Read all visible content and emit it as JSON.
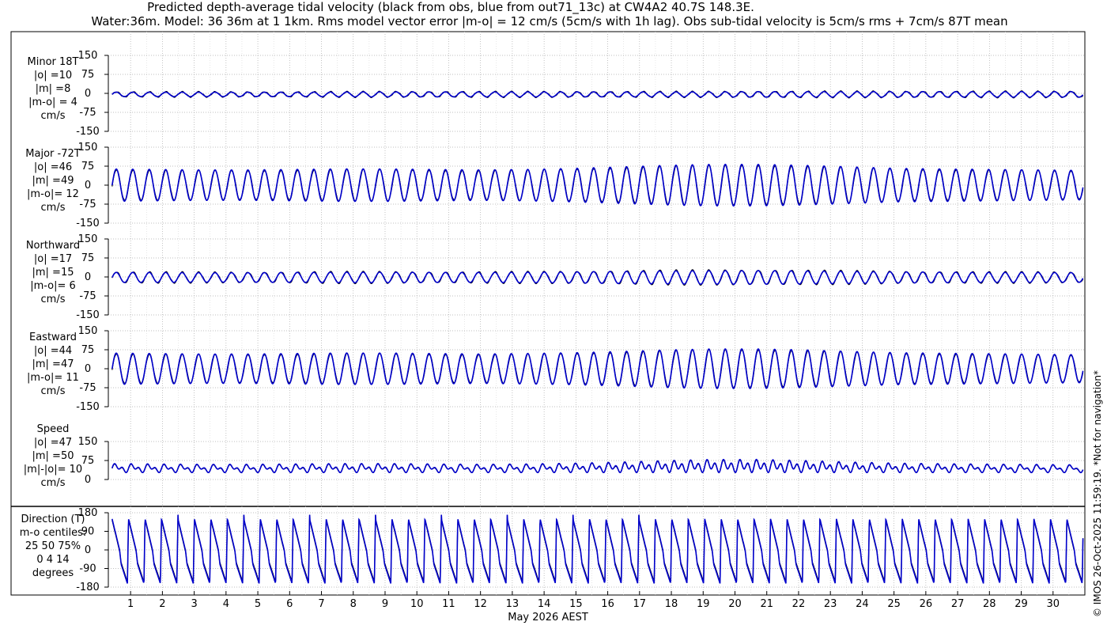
{
  "title": "Predicted depth-average tidal velocity (black from obs, blue from out71_13c) at CW4A2 40.7S 148.3E.",
  "subtitle": "Water:36m. Model: 36 36m at 1 1km. Rms model vector error |m-o| = 12 cm/s (5cm/s with 1h lag). Obs sub-tidal velocity is 5cm/s rms + 7cm/s 87T mean",
  "xlabel": "May 2026 AEST",
  "watermark": "© IMOS 26-Oct-2025 11:59:19. *Not for navigation*",
  "colors": {
    "obs": "#000000",
    "model": "#0000cc",
    "grid": "#aaaaaa"
  },
  "chart_data": [
    {
      "type": "line",
      "panel": "minor",
      "label_lines": [
        "Minor 18T",
        "|o| =10",
        "|m| =8",
        "|m-o| = 4",
        "cm/s"
      ],
      "ylim": [
        -150,
        150
      ],
      "yticks": [
        150,
        75,
        0,
        -75,
        -150
      ],
      "xlim": [
        0.3,
        31
      ],
      "x_ticks": [
        1,
        2,
        3,
        4,
        5,
        6,
        7,
        8,
        9,
        10,
        11,
        12,
        13,
        14,
        15,
        16,
        17,
        18,
        19,
        20,
        21,
        22,
        23,
        24,
        25,
        26,
        27,
        28,
        29,
        30
      ],
      "period_days": 0.5175,
      "amplitude_envelope": [
        9,
        9,
        9,
        9,
        10,
        10,
        10,
        10,
        10,
        10,
        11,
        11,
        11,
        11,
        11,
        11
      ],
      "offset": -4,
      "series": [
        {
          "name": "obs",
          "amp_scale": 1.1
        },
        {
          "name": "model",
          "amp_scale": 1.0
        }
      ]
    },
    {
      "type": "line",
      "panel": "major",
      "label_lines": [
        "Major -72T",
        "|o| =46",
        "|m| =49",
        "|m-o|= 12",
        "cm/s"
      ],
      "ylim": [
        -150,
        150
      ],
      "yticks": [
        150,
        75,
        0,
        -75,
        -150
      ],
      "xlim": [
        0.3,
        31
      ],
      "x_ticks": [
        1,
        2,
        3,
        4,
        5,
        6,
        7,
        8,
        9,
        10,
        11,
        12,
        13,
        14,
        15,
        16,
        17,
        18,
        19,
        20,
        21,
        22,
        23,
        24,
        25,
        26,
        27,
        28,
        29,
        30
      ],
      "period_days": 0.5175,
      "amplitude_envelope": [
        64,
        62,
        60,
        60,
        62,
        64,
        64,
        62,
        60,
        62,
        66,
        72,
        78,
        82,
        82,
        78,
        72,
        66,
        64,
        62,
        60,
        58
      ],
      "offset": 0,
      "series": [
        {
          "name": "obs",
          "amp_scale": 0.96
        },
        {
          "name": "model",
          "amp_scale": 1.0
        }
      ]
    },
    {
      "type": "line",
      "panel": "northward",
      "label_lines": [
        "Northward",
        "|o| =17",
        "|m| =15",
        "|m-o|= 6",
        "cm/s"
      ],
      "ylim": [
        -150,
        150
      ],
      "yticks": [
        150,
        75,
        0,
        -75,
        -150
      ],
      "xlim": [
        0.3,
        31
      ],
      "x_ticks": [
        1,
        2,
        3,
        4,
        5,
        6,
        7,
        8,
        9,
        10,
        11,
        12,
        13,
        14,
        15,
        16,
        17,
        18,
        19,
        20,
        21,
        22,
        23,
        24,
        25,
        26,
        27,
        28,
        29,
        30
      ],
      "period_days": 0.5175,
      "amplitude_envelope": [
        20,
        20,
        19,
        19,
        20,
        21,
        21,
        20,
        20,
        21,
        22,
        24,
        26,
        27,
        27,
        26,
        24,
        22,
        21,
        20,
        20,
        19
      ],
      "offset": -2,
      "series": [
        {
          "name": "obs",
          "amp_scale": 1.08
        },
        {
          "name": "model",
          "amp_scale": 1.0
        }
      ]
    },
    {
      "type": "line",
      "panel": "eastward",
      "label_lines": [
        "Eastward",
        "|o| =44",
        "|m| =47",
        "|m-o|= 11",
        "cm/s"
      ],
      "ylim": [
        -150,
        150
      ],
      "yticks": [
        150,
        75,
        0,
        -75,
        -150
      ],
      "xlim": [
        0.3,
        31
      ],
      "x_ticks": [
        1,
        2,
        3,
        4,
        5,
        6,
        7,
        8,
        9,
        10,
        11,
        12,
        13,
        14,
        15,
        16,
        17,
        18,
        19,
        20,
        21,
        22,
        23,
        24,
        25,
        26,
        27,
        28,
        29,
        30
      ],
      "period_days": 0.5175,
      "amplitude_envelope": [
        62,
        60,
        58,
        58,
        60,
        62,
        62,
        60,
        58,
        60,
        63,
        68,
        74,
        78,
        78,
        74,
        68,
        63,
        61,
        59,
        57,
        55
      ],
      "offset": 0,
      "series": [
        {
          "name": "obs",
          "amp_scale": 0.96
        },
        {
          "name": "model",
          "amp_scale": 1.0
        }
      ]
    },
    {
      "type": "line",
      "panel": "speed",
      "label_lines": [
        "Speed",
        "|o| =47",
        "|m| =50",
        "|m|-|o|= 10",
        "cm/s"
      ],
      "ylim": [
        0,
        150
      ],
      "yticks": [
        150,
        75,
        0
      ],
      "xlim": [
        0.3,
        31
      ],
      "x_ticks": [
        1,
        2,
        3,
        4,
        5,
        6,
        7,
        8,
        9,
        10,
        11,
        12,
        13,
        14,
        15,
        16,
        17,
        18,
        19,
        20,
        21,
        22,
        23,
        24,
        25,
        26,
        27,
        28,
        29,
        30
      ],
      "period_days": 0.5175,
      "amplitude_envelope": [
        62,
        60,
        58,
        58,
        60,
        62,
        62,
        60,
        58,
        60,
        64,
        70,
        78,
        84,
        84,
        78,
        70,
        64,
        61,
        59,
        57,
        55
      ],
      "offset": 0,
      "series": [
        {
          "name": "obs",
          "amp_scale": 0.96
        },
        {
          "name": "model",
          "amp_scale": 1.0
        }
      ]
    },
    {
      "type": "line",
      "panel": "direction",
      "label_lines": [
        "Direction (T)",
        "m-o centiles:",
        "25  50  75%",
        "0   4  14",
        "degrees"
      ],
      "ylim": [
        -180,
        180
      ],
      "yticks": [
        180,
        90,
        0,
        -90,
        -180
      ],
      "xlim": [
        0.3,
        31
      ],
      "x_ticks": [
        1,
        2,
        3,
        4,
        5,
        6,
        7,
        8,
        9,
        10,
        11,
        12,
        13,
        14,
        15,
        16,
        17,
        18,
        19,
        20,
        21,
        22,
        23,
        24,
        25,
        26,
        27,
        28,
        29,
        30
      ],
      "period_days": 0.5175,
      "series": [
        {
          "name": "obs"
        },
        {
          "name": "model"
        }
      ]
    }
  ]
}
